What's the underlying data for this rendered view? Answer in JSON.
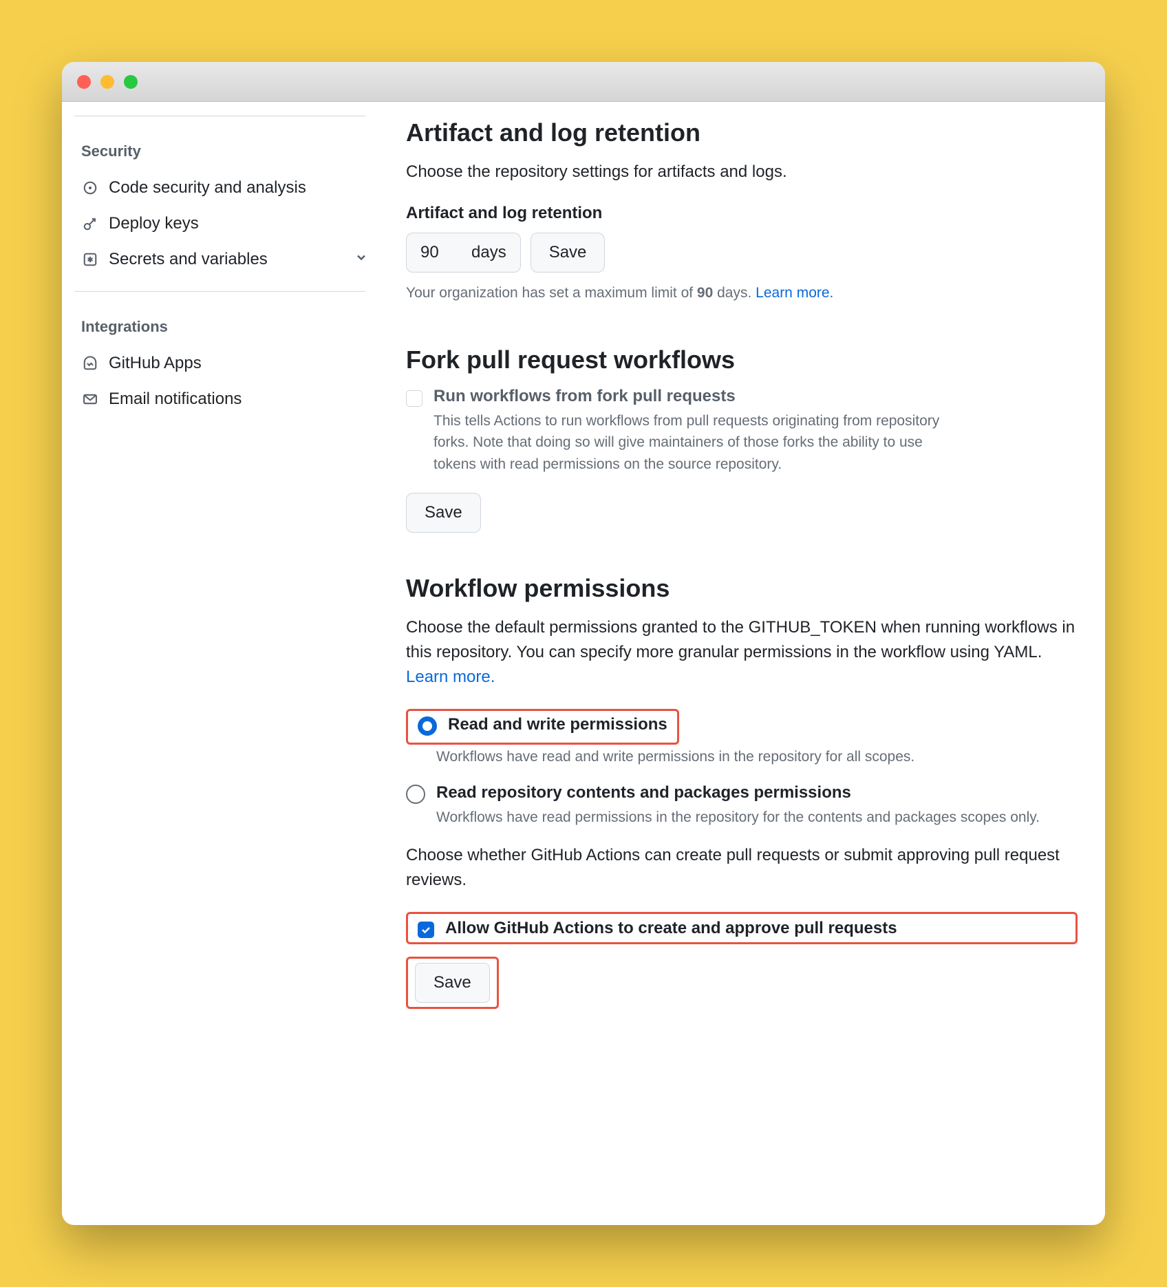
{
  "sidebar": {
    "groups": [
      {
        "heading": "Security",
        "items": [
          {
            "label": "Code security and analysis",
            "icon": "scan",
            "expandable": false
          },
          {
            "label": "Deploy keys",
            "icon": "key",
            "expandable": false
          },
          {
            "label": "Secrets and variables",
            "icon": "asterisk",
            "expandable": true
          }
        ]
      },
      {
        "heading": "Integrations",
        "items": [
          {
            "label": "GitHub Apps",
            "icon": "hubot",
            "expandable": false
          },
          {
            "label": "Email notifications",
            "icon": "mail",
            "expandable": false
          }
        ]
      }
    ]
  },
  "artifact": {
    "title": "Artifact and log retention",
    "desc": "Choose the repository settings for artifacts and logs.",
    "label": "Artifact and log retention",
    "value": "90",
    "unit": "days",
    "save": "Save",
    "note_pre": "Your organization has set a maximum limit of ",
    "note_bold": "90",
    "note_post": " days. ",
    "learn": "Learn more."
  },
  "fork": {
    "title": "Fork pull request workflows",
    "option_title": "Run workflows from fork pull requests",
    "option_desc": "This tells Actions to run workflows from pull requests originating from repository forks. Note that doing so will give maintainers of those forks the ability to use tokens with read permissions on the source repository.",
    "save": "Save"
  },
  "wp": {
    "title": "Workflow permissions",
    "desc_pre": "Choose the default permissions granted to the GITHUB_TOKEN when running workflows in this repository. You can specify more granular permissions in the workflow using YAML. ",
    "learn": "Learn more.",
    "r1_title": "Read and write permissions",
    "r1_desc": "Workflows have read and write permissions in the repository for all scopes.",
    "r2_title": "Read repository contents and packages permissions",
    "r2_desc": "Workflows have read permissions in the repository for the contents and packages scopes only.",
    "sub_desc": "Choose whether GitHub Actions can create pull requests or submit approving pull request reviews.",
    "cb_title": "Allow GitHub Actions to create and approve pull requests",
    "save": "Save"
  }
}
